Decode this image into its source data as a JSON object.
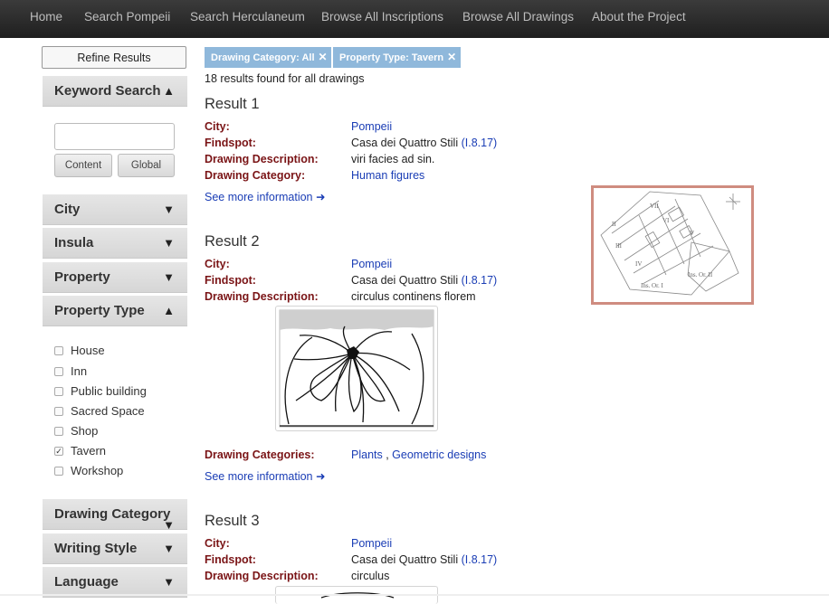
{
  "nav": {
    "items": [
      "Home",
      "Search Pompeii",
      "Search Herculaneum",
      "Browse All Inscriptions",
      "Browse All Drawings",
      "About the Project"
    ]
  },
  "sidebar": {
    "refine_label": "Refine Results",
    "keyword": {
      "title": "Keyword Search",
      "arrow": "▲",
      "input_value": "",
      "content_label": "Content",
      "global_label": "Global"
    },
    "facets": [
      {
        "label": "City",
        "arrow": "▼"
      },
      {
        "label": "Insula",
        "arrow": "▼"
      },
      {
        "label": "Property",
        "arrow": "▼"
      },
      {
        "label": "Property Type",
        "arrow": "▲"
      }
    ],
    "property_types": [
      {
        "label": "House",
        "checked": false
      },
      {
        "label": "Inn",
        "checked": false
      },
      {
        "label": "Public building",
        "checked": false
      },
      {
        "label": "Sacred Space",
        "checked": false
      },
      {
        "label": "Shop",
        "checked": false
      },
      {
        "label": "Tavern",
        "checked": true
      },
      {
        "label": "Workshop",
        "checked": false
      }
    ],
    "lower_facets": [
      {
        "label": "Drawing Category",
        "arrow": "▼"
      },
      {
        "label": "Writing Style",
        "arrow": "▼"
      },
      {
        "label": "Language",
        "arrow": "▼"
      }
    ]
  },
  "filters": {
    "tags": [
      "Drawing Category: All",
      "Property Type: Tavern"
    ],
    "remove_glyph": "✕"
  },
  "results_count": "18 results found for all drawings",
  "results": [
    {
      "title": "Result 1",
      "city_label": "City:",
      "city": "Pompeii",
      "findspot_label": "Findspot:",
      "findspot_text": "Casa dei Quattro Stili",
      "findspot_link": "(I.8.17)",
      "description_label": "Drawing Description:",
      "description": "viri facies ad sin.",
      "category_label": "Drawing Category:",
      "category": "Human figures",
      "more": "See more information ➜"
    },
    {
      "title": "Result 2",
      "city_label": "City:",
      "city": "Pompeii",
      "findspot_label": "Findspot:",
      "findspot_text": "Casa dei Quattro Stili",
      "findspot_link": "(I.8.17)",
      "description_label": "Drawing Description:",
      "description": "circulus continens florem",
      "categories_label": "Drawing Categories:",
      "categories": [
        "Plants",
        "Geometric designs"
      ],
      "category_sep": " , ",
      "more": "See more information ➜"
    },
    {
      "title": "Result 3",
      "city_label": "City:",
      "city": "Pompeii",
      "findspot_label": "Findspot:",
      "findspot_text": "Casa dei Quattro Stili",
      "findspot_link": "(I.8.17)",
      "description_label": "Drawing Description:",
      "description": "circulus"
    }
  ],
  "map": {
    "labels": [
      "VII",
      "II",
      "VI",
      "III",
      "IV",
      "V",
      "Ins. Or. I",
      "Ins. Or. II"
    ]
  },
  "colors": {
    "field_label": "#7a1416",
    "link": "#1a3db5",
    "tag_bg": "#8fb8db",
    "map_border": "#cf8c80",
    "nav_bg": "#2a2a2a"
  }
}
